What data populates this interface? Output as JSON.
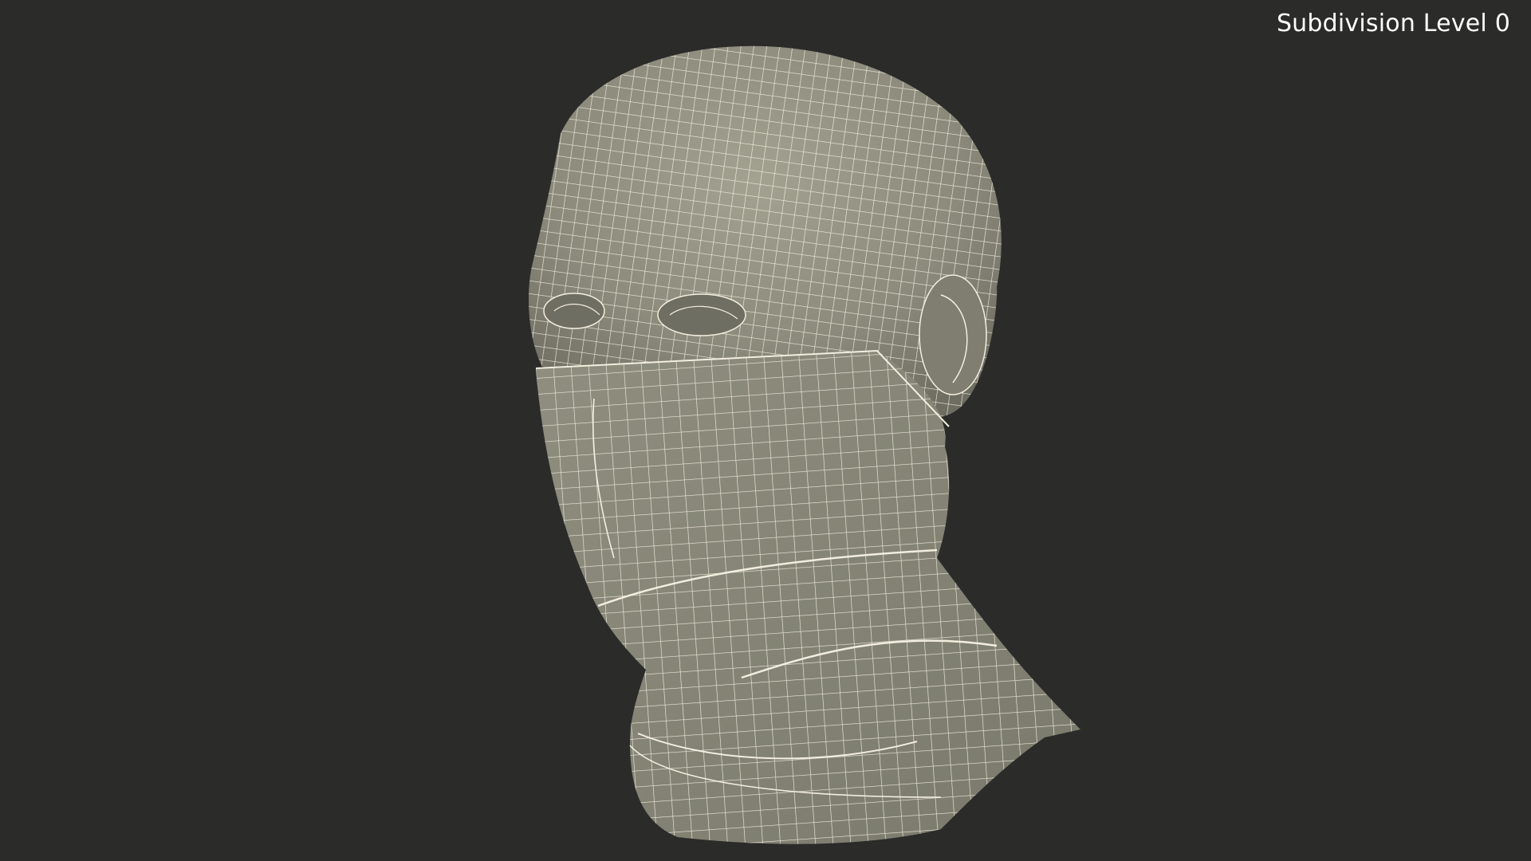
{
  "viewport": {
    "label": "Subdivision Level 0",
    "background_color": "#2b2b2a"
  },
  "model": {
    "subject": "head-with-neck-gaiter-wireframe",
    "surface_color": "#8c8b7c",
    "wire_color": "#f2eedf"
  }
}
